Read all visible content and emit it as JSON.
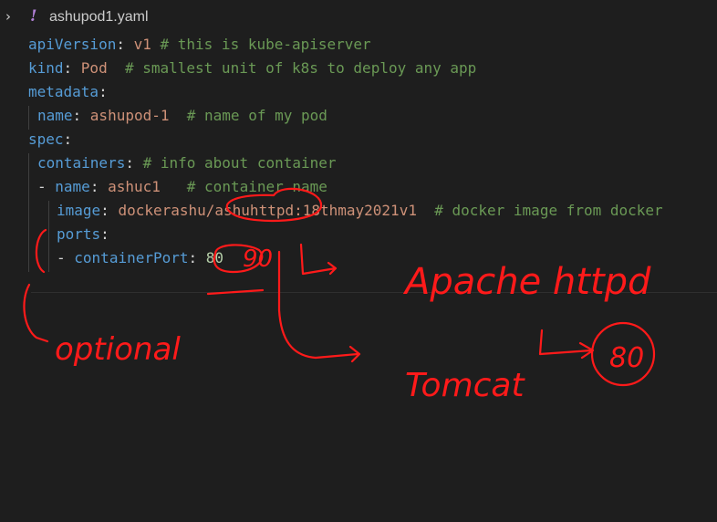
{
  "tab": {
    "chevron": "›",
    "yaml_icon": "!",
    "filename": "ashupod1.yaml"
  },
  "code": {
    "line1": {
      "key": "apiVersion",
      "value": "v1",
      "comment": "# this is kube-apiserver"
    },
    "line2": {
      "key": "kind",
      "value": "Pod",
      "comment": "# smallest unit of k8s to deploy any app"
    },
    "line3": {
      "key": "metadata"
    },
    "line4": {
      "key": "name",
      "value": "ashupod-1",
      "comment": "# name of my pod"
    },
    "line5": {
      "key": "spec"
    },
    "line6": {
      "key": "containers",
      "comment": "# info about container"
    },
    "line7": {
      "dash": "-",
      "key": "name",
      "value": "ashuc1",
      "comment": "# container name"
    },
    "line8": {
      "key": "image",
      "value": "dockerashu/ashuhttpd:18thmay2021v1",
      "comment": "# docker image from docker"
    },
    "line9": {
      "key": "ports"
    },
    "line10": {
      "dash": "-",
      "key": "containerPort",
      "value": "80"
    }
  },
  "annotations": {
    "note_90": "90",
    "note_optional": "optional",
    "note_apache": "Apache httpd",
    "note_tomcat": "Tomcat",
    "note_80": "80"
  },
  "colors": {
    "background": "#1e1e1e",
    "key": "#569cd6",
    "string": "#ce9178",
    "number": "#b5cea8",
    "comment": "#6a9955",
    "ink": "#ff1a1a"
  }
}
